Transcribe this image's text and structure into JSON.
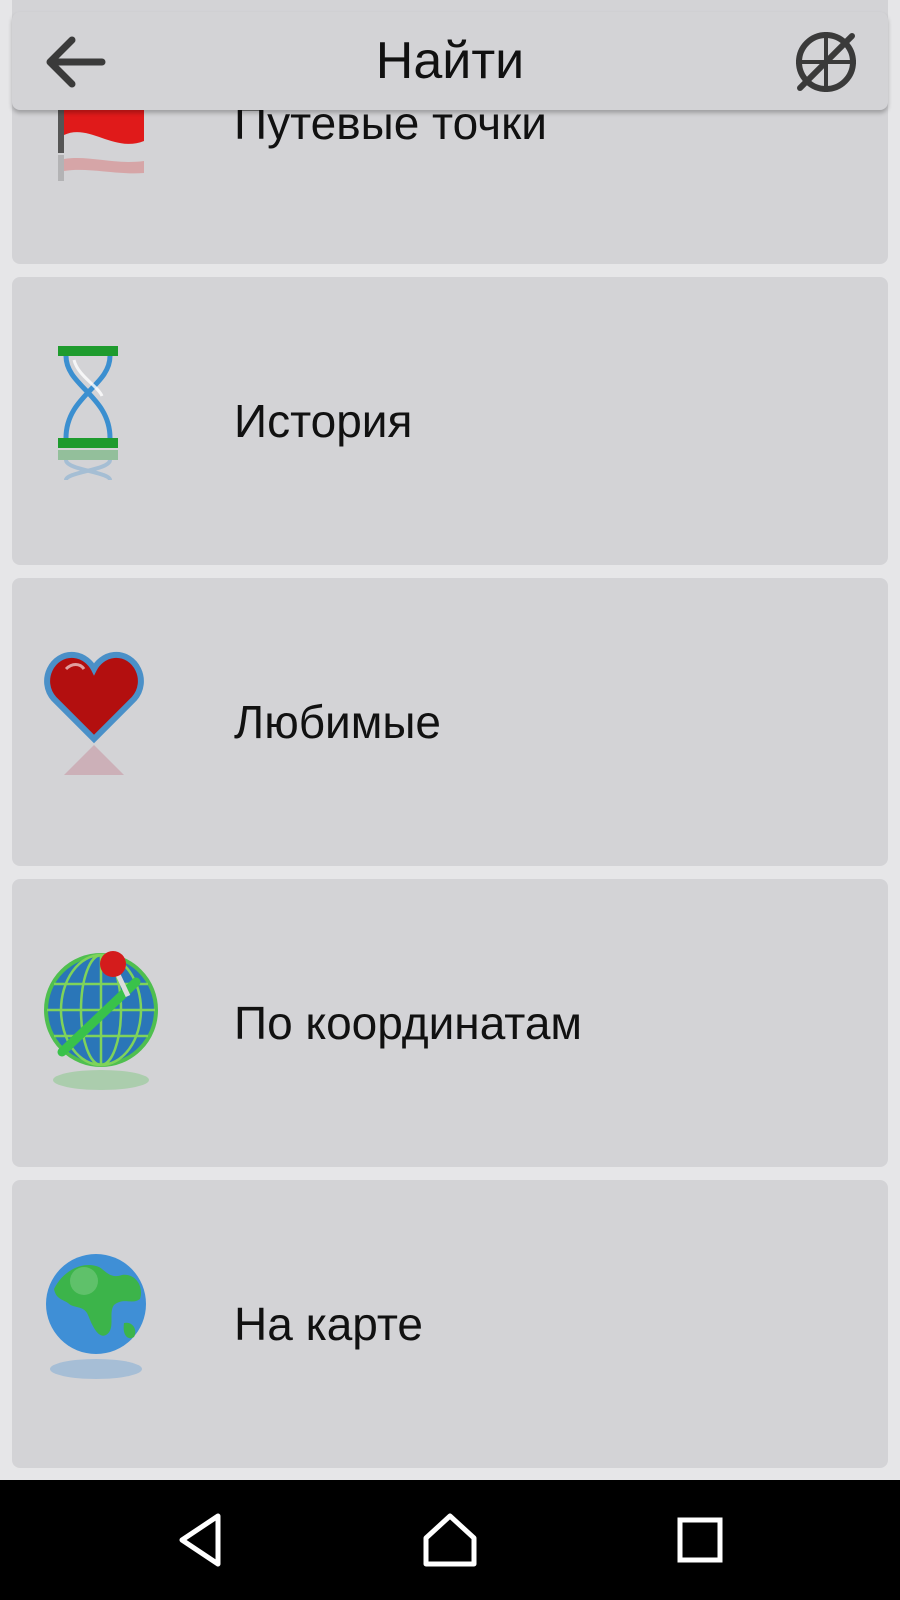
{
  "header": {
    "title": "Найти",
    "back_icon": "arrow-left-icon",
    "compass_icon": "compass-icon"
  },
  "items": [
    {
      "label": "Путевые точки",
      "icon": "waypoint-flag-icon"
    },
    {
      "label": "История",
      "icon": "hourglass-icon"
    },
    {
      "label": "Любимые",
      "icon": "heart-icon"
    },
    {
      "label": "По координатам",
      "icon": "coordinates-globe-icon"
    },
    {
      "label": "На карте",
      "icon": "earth-globe-icon"
    }
  ],
  "navbar": {
    "back_icon": "nav-back-icon",
    "home_icon": "nav-home-icon",
    "recents_icon": "nav-recents-icon",
    "background": "#000000"
  },
  "colors": {
    "card": "#d3d3d6",
    "page": "#e6e6e8",
    "flag": "#e01a1a",
    "heart": "#b30f0f",
    "hourglass_frame": "#1e9b2e"
  }
}
